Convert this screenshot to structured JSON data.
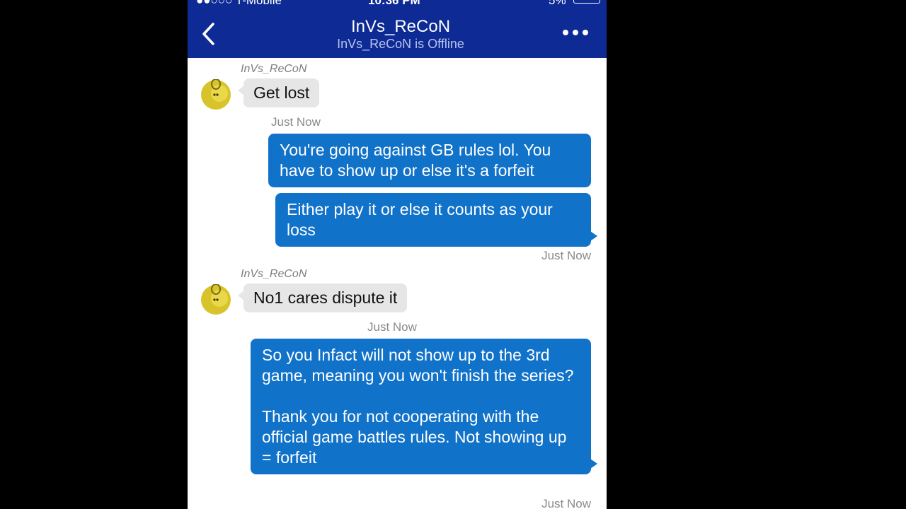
{
  "status_bar": {
    "carrier": "●●○○○ T-Mobile",
    "time": "10:36 PM",
    "battery": "5%"
  },
  "header": {
    "title": "InVs_ReCoN",
    "subtitle": "InVs_ReCoN is Offline",
    "back_icon": "chevron-left-icon",
    "more_icon": "more-dots-icon",
    "background": "#0d2a95"
  },
  "messages": [
    {
      "direction": "incoming",
      "sender": "InVs_ReCoN",
      "text": "Get lost",
      "timestamp": "Just Now"
    },
    {
      "direction": "outgoing",
      "text": "You're going against GB rules lol. You have to show up or else it's a forfeit"
    },
    {
      "direction": "outgoing",
      "text": "Either play it or else it counts as your loss",
      "timestamp": "Just Now"
    },
    {
      "direction": "incoming",
      "sender": "InVs_ReCoN",
      "text": "No1 cares dispute it",
      "timestamp": "Just Now"
    },
    {
      "direction": "outgoing",
      "text_p1": "So you Infact will not show up to the 3rd game, meaning you won't finish the series?",
      "text_p2": "Thank you for not cooperating with the official game battles rules. Not showing up = forfeit",
      "timestamp": "Just Now"
    }
  ],
  "colors": {
    "outgoing_bubble": "#1172c9",
    "incoming_bubble": "#e6e6e6",
    "avatar": "#d8c42a"
  }
}
